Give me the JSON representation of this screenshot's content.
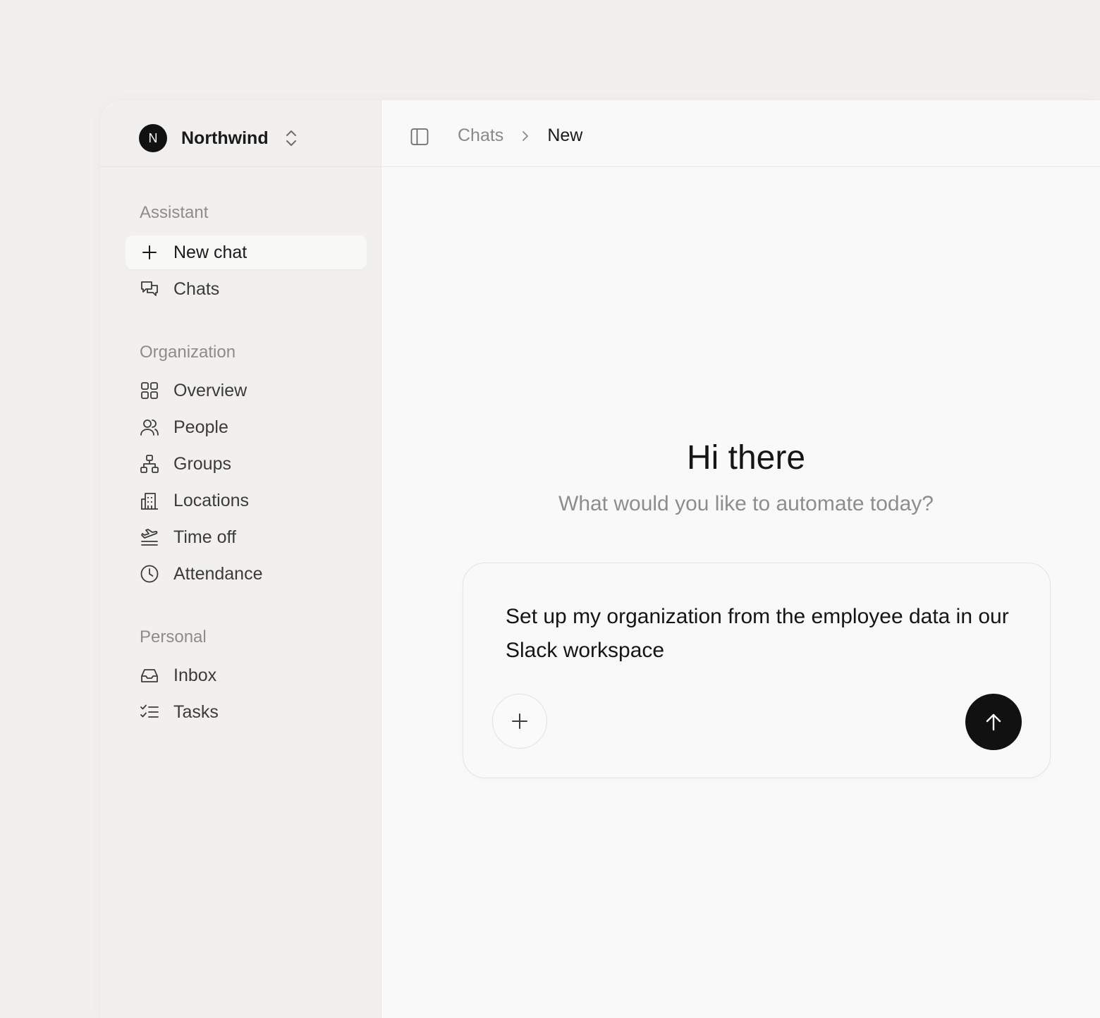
{
  "workspace": {
    "avatar_letter": "N",
    "name": "Northwind",
    "switcher_icon": "chevron-up-down-icon"
  },
  "sidebar": {
    "sections": [
      {
        "label": "Assistant",
        "items": [
          {
            "label": "New chat",
            "icon": "plus-icon",
            "active": true
          },
          {
            "label": "Chats",
            "icon": "chat-bubbles-icon",
            "active": false
          }
        ]
      },
      {
        "label": "Organization",
        "items": [
          {
            "label": "Overview",
            "icon": "grid-icon",
            "active": false
          },
          {
            "label": "People",
            "icon": "users-icon",
            "active": false
          },
          {
            "label": "Groups",
            "icon": "hierarchy-icon",
            "active": false
          },
          {
            "label": "Locations",
            "icon": "building-icon",
            "active": false
          },
          {
            "label": "Time off",
            "icon": "plane-takeoff-icon",
            "active": false
          },
          {
            "label": "Attendance",
            "icon": "clock-icon",
            "active": false
          }
        ]
      },
      {
        "label": "Personal",
        "items": [
          {
            "label": "Inbox",
            "icon": "inbox-icon",
            "active": false
          },
          {
            "label": "Tasks",
            "icon": "checklist-icon",
            "active": false
          }
        ]
      }
    ]
  },
  "topbar": {
    "toggle_icon": "sidebar-toggle-icon",
    "breadcrumb": {
      "parent": "Chats",
      "separator_icon": "chevron-right-icon",
      "current": "New"
    }
  },
  "main": {
    "title": "Hi there",
    "subtitle": "What would you like to automate today?",
    "composer": {
      "text": "Set up my organization from the employee data in our Slack workspace",
      "attach_icon": "plus-icon",
      "send_icon": "arrow-up-icon"
    }
  },
  "colors": {
    "background": "#f1f0ee",
    "main_background": "#f9f9f9",
    "accent": "#111111",
    "muted_text": "#8e8d8a"
  }
}
